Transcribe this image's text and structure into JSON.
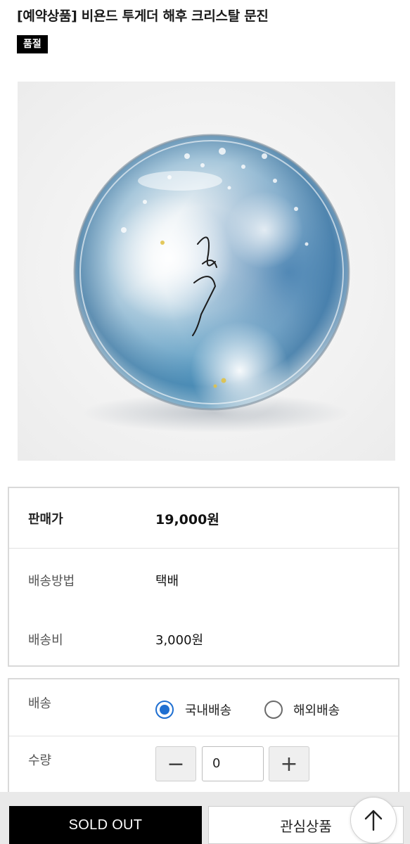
{
  "product": {
    "title": "[예약상품] 비욘드 투게더 해후 크리스탈 문진",
    "status_badge": "품절",
    "image_caption": "해후"
  },
  "info": {
    "price_label": "판매가",
    "price_value": "19,000원",
    "method_label": "배송방법",
    "method_value": "택배",
    "fee_label": "배송비",
    "fee_value": "3,000원"
  },
  "options": {
    "shipping_label": "배송",
    "shipping_choices": [
      "국내배송",
      "해외배송"
    ],
    "shipping_selected": "국내배송",
    "quantity_label": "수량",
    "quantity_value": "0",
    "minus_symbol": "−",
    "plus_symbol": "+"
  },
  "actions": {
    "soldout_label": "SOLD OUT",
    "wishlist_label": "관심상품"
  },
  "colors": {
    "accent": "#1f6fd1",
    "soldout_bg": "#000000"
  },
  "icons": {
    "top": "arrow-up-icon"
  }
}
